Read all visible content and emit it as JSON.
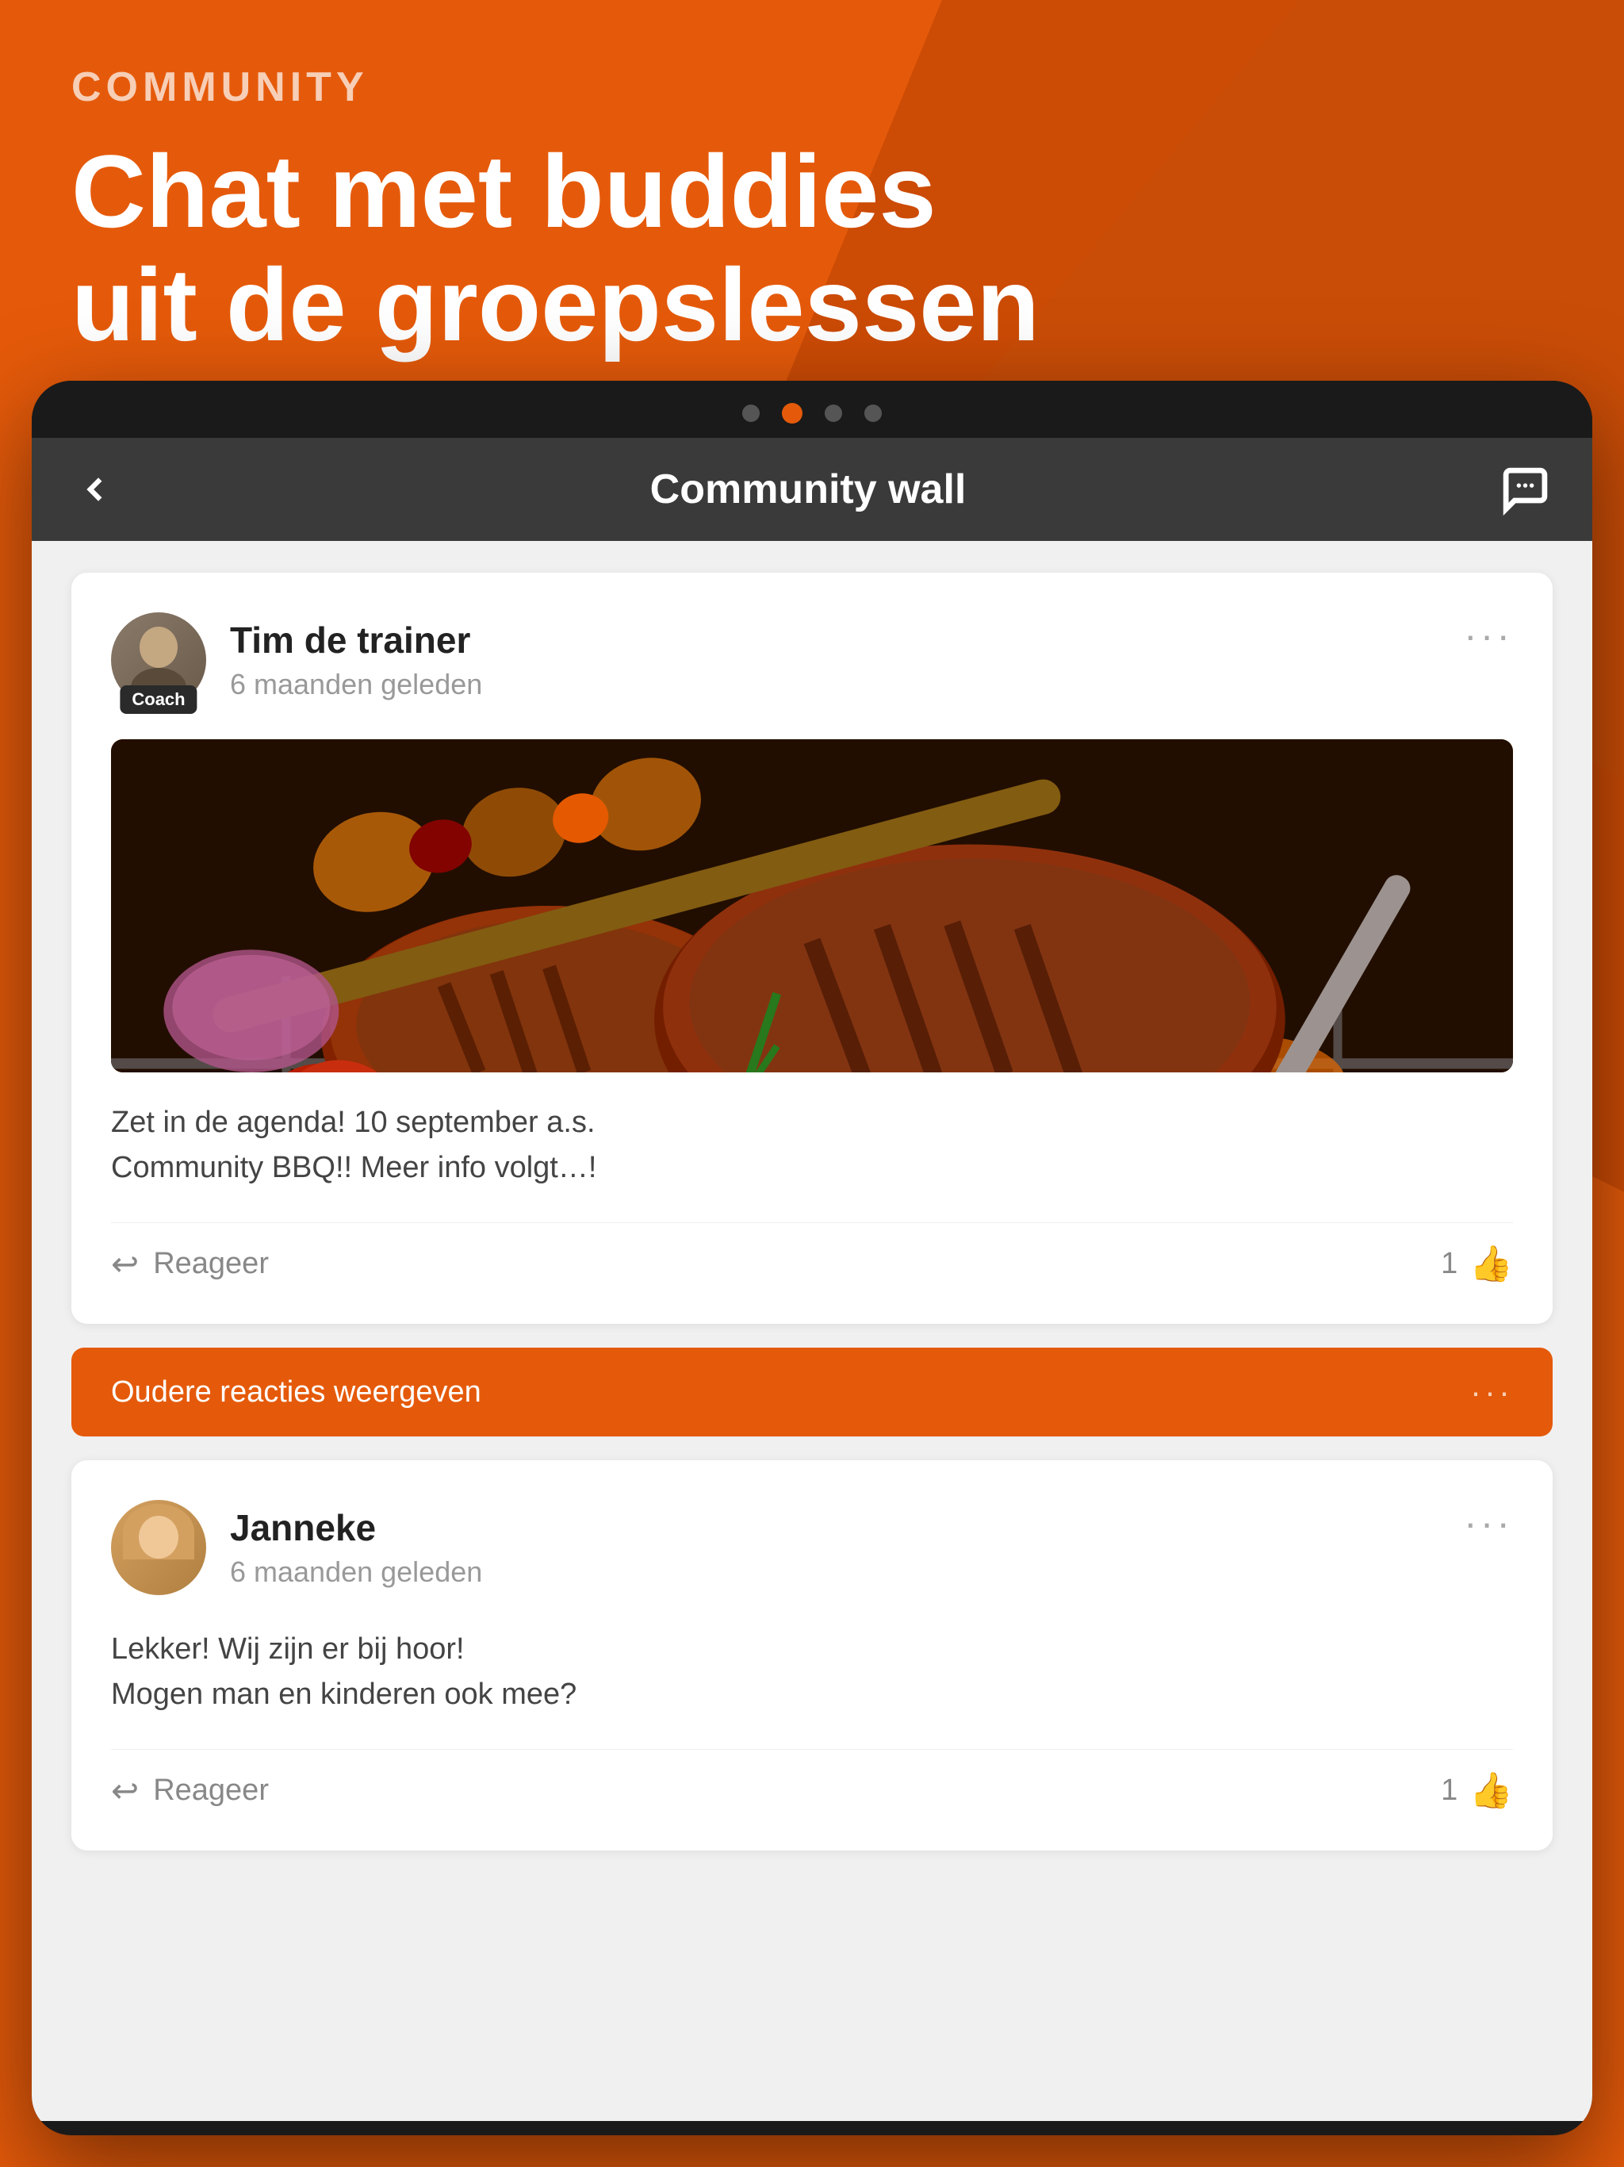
{
  "background": {
    "color": "#e55a0a"
  },
  "header": {
    "community_label": "COMMUNITY",
    "hero_title_line1": "Chat met buddies",
    "hero_title_line2": "uit de groepslessen"
  },
  "device": {
    "dots": [
      {
        "active": false
      },
      {
        "active": true
      },
      {
        "active": false
      },
      {
        "active": false
      }
    ]
  },
  "nav_bar": {
    "title": "Community wall",
    "back_label": "back",
    "chat_label": "chat"
  },
  "posts": [
    {
      "id": "post-1",
      "author_name": "Tim de trainer",
      "author_time": "6 maanden geleden",
      "badge": "Coach",
      "has_image": true,
      "image_alt": "BBQ grill with meat",
      "post_text_line1": "Zet in de agenda! 10 september a.s.",
      "post_text_line2": "Community BBQ!! Meer info volgt…!",
      "reply_label": "Reageer",
      "like_count": "1",
      "menu_dots": "···"
    },
    {
      "id": "post-2",
      "author_name": "Janneke",
      "author_time": "6 maanden geleden",
      "badge": null,
      "has_image": false,
      "post_text_line1": "Lekker! Wij zijn er bij hoor!",
      "post_text_line2": "Mogen man en kinderen ook mee?",
      "reply_label": "Reageer",
      "like_count": "1",
      "menu_dots": "···"
    }
  ],
  "older_reactions": {
    "label": "Oudere reacties weergeven",
    "dots": "···"
  }
}
